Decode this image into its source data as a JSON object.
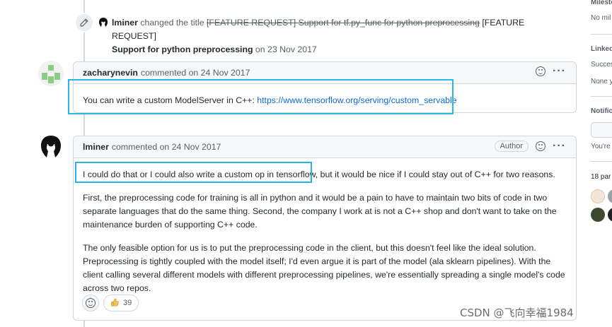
{
  "event": {
    "actor": "lminer",
    "action": "changed the title",
    "old_title": "[FEATURE REQUEST] Support for tf.py_func for python preprocessing",
    "new_title_prefix": "[FEATURE REQUEST]",
    "new_title_rest": "Support for python preprocessing",
    "date_text": "on 23 Nov 2017"
  },
  "comment1": {
    "author": "zacharynevin",
    "meta": "commented on 24 Nov 2017",
    "body_text": "You can write a custom ModelServer in C++: ",
    "link": "https://www.tensorflow.org/serving/custom_servable"
  },
  "comment2": {
    "author": "lminer",
    "meta": "commented on 24 Nov 2017",
    "badge": "Author",
    "p1_highlight": "I could do that or I could also write a custom op in tensorflow,",
    "p1_rest": " but it would be nice if I could stay out of C++ for two reasons.",
    "p2": "First, the preprocessing code for training is all in python and it would be a pain to have to maintain two bits of code in two separate languages that do the same thing. Second, the company I work at is not a C++ shop and don't want to take on the maintenance burden of supporting C++ code.",
    "p3": "The only feasible option for us is to put the preprocessing code in the client, but this doesn't feel like the ideal solution. Preprocessing is tightly coupled with the model itself; I'd even argue it is part of the model (ala sklearn pipelines). With the client calling several different models with different preprocessing pipelines, we're essentially spreading a single model's code across two repos.",
    "thumbs_count": "39"
  },
  "sidebar": {
    "milestone_heading": "Milesto",
    "milestone_value": "No mil",
    "linked_heading": "Linked",
    "linked_line1": "Succes",
    "linked_line2": "None y",
    "notif_heading": "Notific",
    "notif_text": "You're",
    "participants": "18 par"
  },
  "watermark": "CSDN @飞向幸福1984",
  "colors": {
    "highlight": "#29b6e8",
    "link": "#0969da"
  }
}
